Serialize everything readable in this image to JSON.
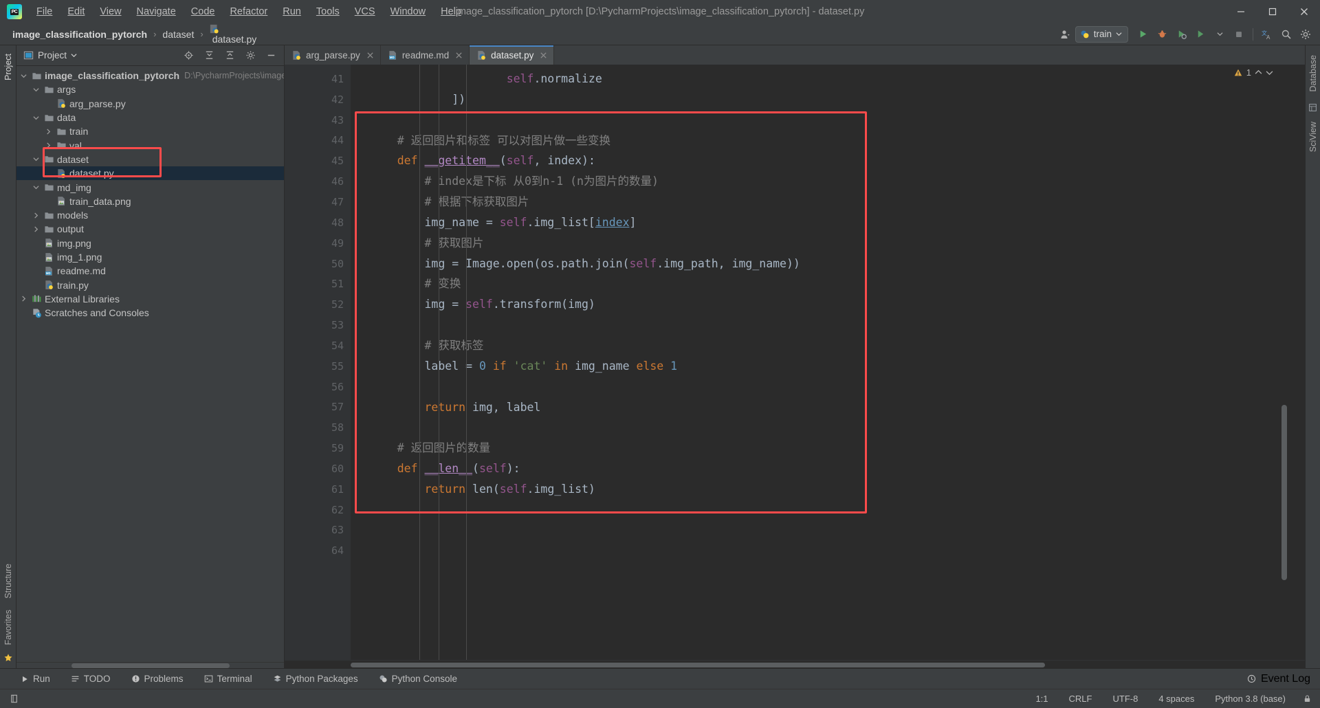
{
  "window": {
    "title": "image_classification_pytorch [D:\\PycharmProjects\\image_classification_pytorch] - dataset.py",
    "minimize_icon": "minimize-icon",
    "maximize_icon": "maximize-icon",
    "close_icon": "close-icon"
  },
  "menu": {
    "items": [
      {
        "label": "File"
      },
      {
        "label": "Edit"
      },
      {
        "label": "View"
      },
      {
        "label": "Navigate"
      },
      {
        "label": "Code"
      },
      {
        "label": "Refactor"
      },
      {
        "label": "Run"
      },
      {
        "label": "Tools"
      },
      {
        "label": "VCS"
      },
      {
        "label": "Window"
      },
      {
        "label": "Help"
      }
    ]
  },
  "breadcrumb": {
    "items": [
      {
        "label": "image_classification_pytorch",
        "icon": ""
      },
      {
        "label": "dataset",
        "icon": ""
      },
      {
        "label": "dataset.py",
        "icon": "python-file-icon"
      }
    ],
    "separator": "›"
  },
  "toolbar": {
    "run_config_label": "train",
    "run_config_icon": "python-icon",
    "dropdown_icon": "chevron-down-icon",
    "account_icon": "account-icon",
    "run_icon": "run-icon",
    "debug_icon": "debug-icon",
    "coverage_icon": "run-coverage-icon",
    "profile_icon": "profile-icon",
    "stop_icon": "stop-icon",
    "translate_icon": "translate-icon",
    "search_icon": "search-icon",
    "settings_icon": "gear-icon"
  },
  "left_strip": {
    "top_items": [
      {
        "label": "Project"
      }
    ],
    "bottom_items": [
      {
        "label": "Structure"
      },
      {
        "label": "Favorites"
      }
    ]
  },
  "right_strip": {
    "items": [
      {
        "label": "Database"
      },
      {
        "label": "SciView"
      }
    ]
  },
  "project_panel": {
    "title": "Project",
    "dropdown_icon": "chevron-down-icon",
    "icons": [
      {
        "name": "locate-icon"
      },
      {
        "name": "collapse-all-icon"
      },
      {
        "name": "expand-all-icon"
      },
      {
        "name": "gear-icon"
      },
      {
        "name": "hide-icon"
      }
    ],
    "tree": [
      {
        "depth": 0,
        "arrow": "open",
        "icon": "folder-icon",
        "label": "image_classification_pytorch",
        "bold": true,
        "path": "D:\\PycharmProjects\\image_",
        "selected": false
      },
      {
        "depth": 1,
        "arrow": "open",
        "icon": "folder-icon",
        "label": "args",
        "bold": false,
        "path": "",
        "selected": false
      },
      {
        "depth": 2,
        "arrow": "none",
        "icon": "python-file-icon",
        "label": "arg_parse.py",
        "bold": false,
        "path": "",
        "selected": false
      },
      {
        "depth": 1,
        "arrow": "open",
        "icon": "folder-icon",
        "label": "data",
        "bold": false,
        "path": "",
        "selected": false
      },
      {
        "depth": 2,
        "arrow": "closed",
        "icon": "folder-icon",
        "label": "train",
        "bold": false,
        "path": "",
        "selected": false
      },
      {
        "depth": 2,
        "arrow": "closed",
        "icon": "folder-icon",
        "label": "val",
        "bold": false,
        "path": "",
        "selected": false
      },
      {
        "depth": 1,
        "arrow": "open",
        "icon": "folder-icon",
        "label": "dataset",
        "bold": false,
        "path": "",
        "selected": false
      },
      {
        "depth": 2,
        "arrow": "none",
        "icon": "python-file-icon",
        "label": "dataset.py",
        "bold": false,
        "path": "",
        "selected": true
      },
      {
        "depth": 1,
        "arrow": "open",
        "icon": "folder-icon",
        "label": "md_img",
        "bold": false,
        "path": "",
        "selected": false
      },
      {
        "depth": 2,
        "arrow": "none",
        "icon": "image-file-icon",
        "label": "train_data.png",
        "bold": false,
        "path": "",
        "selected": false
      },
      {
        "depth": 1,
        "arrow": "closed",
        "icon": "folder-icon",
        "label": "models",
        "bold": false,
        "path": "",
        "selected": false
      },
      {
        "depth": 1,
        "arrow": "closed",
        "icon": "folder-icon",
        "label": "output",
        "bold": false,
        "path": "",
        "selected": false
      },
      {
        "depth": 1,
        "arrow": "none",
        "icon": "image-file-icon",
        "label": "img.png",
        "bold": false,
        "path": "",
        "selected": false
      },
      {
        "depth": 1,
        "arrow": "none",
        "icon": "image-file-icon",
        "label": "img_1.png",
        "bold": false,
        "path": "",
        "selected": false
      },
      {
        "depth": 1,
        "arrow": "none",
        "icon": "markdown-file-icon",
        "label": "readme.md",
        "bold": false,
        "path": "",
        "selected": false
      },
      {
        "depth": 1,
        "arrow": "none",
        "icon": "python-file-icon",
        "label": "train.py",
        "bold": false,
        "path": "",
        "selected": false
      },
      {
        "depth": 0,
        "arrow": "closed",
        "icon": "library-icon",
        "label": "External Libraries",
        "bold": false,
        "path": "",
        "selected": false
      },
      {
        "depth": 0,
        "arrow": "none",
        "icon": "scratches-icon",
        "label": "Scratches and Consoles",
        "bold": false,
        "path": "",
        "selected": false
      }
    ]
  },
  "editor": {
    "tabs": [
      {
        "label": "arg_parse.py",
        "icon": "python-file-icon",
        "active": false,
        "close_icon": "close-icon"
      },
      {
        "label": "readme.md",
        "icon": "markdown-file-icon",
        "active": false,
        "close_icon": "close-icon"
      },
      {
        "label": "dataset.py",
        "icon": "python-file-icon",
        "active": true,
        "close_icon": "close-icon"
      }
    ],
    "inspection": {
      "count": "1",
      "icon": "warning-icon",
      "up_icon": "chevron-up-icon",
      "down_icon": "chevron-down-icon"
    },
    "first_line_number": 41,
    "lines": [
      {
        "n": 41,
        "fold": false,
        "gutter_icon": "",
        "tokens": [
          {
            "t": "                    ",
            "c": "id"
          },
          {
            "t": "self",
            "c": "self"
          },
          {
            "t": ".",
            "c": "punct"
          },
          {
            "t": "normalize",
            "c": "id"
          }
        ]
      },
      {
        "n": 42,
        "fold": true,
        "gutter_icon": "",
        "tokens": [
          {
            "t": "            ])",
            "c": "punct"
          }
        ]
      },
      {
        "n": 43,
        "fold": false,
        "gutter_icon": "",
        "tokens": []
      },
      {
        "n": 44,
        "fold": false,
        "gutter_icon": "",
        "tokens": [
          {
            "t": "    # 返回图片和标签 可以对图片做一些变换",
            "c": "cmt"
          }
        ]
      },
      {
        "n": 45,
        "fold": true,
        "gutter_icon": "override-icon",
        "tokens": [
          {
            "t": "    ",
            "c": "id"
          },
          {
            "t": "def ",
            "c": "kw"
          },
          {
            "t": "__getitem__",
            "c": "fnmagic"
          },
          {
            "t": "(",
            "c": "punct"
          },
          {
            "t": "self",
            "c": "self"
          },
          {
            "t": ", ",
            "c": "punct"
          },
          {
            "t": "index",
            "c": "param"
          },
          {
            "t": "):",
            "c": "punct"
          }
        ]
      },
      {
        "n": 46,
        "fold": true,
        "gutter_icon": "",
        "tokens": [
          {
            "t": "        # index是下标 从0到n-1 (n为图片的数量)",
            "c": "cmt"
          }
        ]
      },
      {
        "n": 47,
        "fold": true,
        "gutter_icon": "",
        "tokens": [
          {
            "t": "        # 根据下标获取图片",
            "c": "cmt"
          }
        ]
      },
      {
        "n": 48,
        "fold": false,
        "gutter_icon": "",
        "tokens": [
          {
            "t": "        img_name = ",
            "c": "id"
          },
          {
            "t": "self",
            "c": "self"
          },
          {
            "t": ".img_list[",
            "c": "id"
          },
          {
            "t": "index",
            "c": "link"
          },
          {
            "t": "]",
            "c": "punct"
          }
        ]
      },
      {
        "n": 49,
        "fold": false,
        "gutter_icon": "",
        "tokens": [
          {
            "t": "        # 获取图片",
            "c": "cmt"
          }
        ]
      },
      {
        "n": 50,
        "fold": false,
        "gutter_icon": "",
        "tokens": [
          {
            "t": "        img = Image.open(os.path.join(",
            "c": "id"
          },
          {
            "t": "self",
            "c": "self"
          },
          {
            "t": ".img_path, img_name))",
            "c": "id"
          }
        ]
      },
      {
        "n": 51,
        "fold": false,
        "gutter_icon": "",
        "tokens": [
          {
            "t": "        # 变换",
            "c": "cmt"
          }
        ]
      },
      {
        "n": 52,
        "fold": false,
        "gutter_icon": "",
        "tokens": [
          {
            "t": "        img = ",
            "c": "id"
          },
          {
            "t": "self",
            "c": "self"
          },
          {
            "t": ".transform(img)",
            "c": "id"
          }
        ]
      },
      {
        "n": 53,
        "fold": false,
        "gutter_icon": "",
        "tokens": []
      },
      {
        "n": 54,
        "fold": false,
        "gutter_icon": "",
        "tokens": [
          {
            "t": "        # 获取标签",
            "c": "cmt"
          }
        ]
      },
      {
        "n": 55,
        "fold": false,
        "gutter_icon": "",
        "tokens": [
          {
            "t": "        label = ",
            "c": "id"
          },
          {
            "t": "0",
            "c": "num"
          },
          {
            "t": " ",
            "c": "id"
          },
          {
            "t": "if ",
            "c": "kw"
          },
          {
            "t": "'cat'",
            "c": "str"
          },
          {
            "t": " ",
            "c": "id"
          },
          {
            "t": "in ",
            "c": "kw"
          },
          {
            "t": "img_name ",
            "c": "id"
          },
          {
            "t": "else ",
            "c": "kw"
          },
          {
            "t": "1",
            "c": "num"
          }
        ]
      },
      {
        "n": 56,
        "fold": false,
        "gutter_icon": "",
        "tokens": []
      },
      {
        "n": 57,
        "fold": true,
        "gutter_icon": "",
        "tokens": [
          {
            "t": "        ",
            "c": "id"
          },
          {
            "t": "return ",
            "c": "kw"
          },
          {
            "t": "img, label",
            "c": "id"
          }
        ]
      },
      {
        "n": 58,
        "fold": false,
        "gutter_icon": "",
        "tokens": []
      },
      {
        "n": 59,
        "fold": false,
        "gutter_icon": "",
        "tokens": [
          {
            "t": "    # 返回图片的数量",
            "c": "cmt"
          }
        ]
      },
      {
        "n": 60,
        "fold": true,
        "gutter_icon": "",
        "tokens": [
          {
            "t": "    ",
            "c": "id"
          },
          {
            "t": "def ",
            "c": "kw"
          },
          {
            "t": "__len__",
            "c": "fnmagic"
          },
          {
            "t": "(",
            "c": "punct"
          },
          {
            "t": "self",
            "c": "self"
          },
          {
            "t": "):",
            "c": "punct"
          }
        ]
      },
      {
        "n": 61,
        "fold": true,
        "gutter_icon": "",
        "tokens": [
          {
            "t": "        ",
            "c": "id"
          },
          {
            "t": "return ",
            "c": "kw"
          },
          {
            "t": "len(",
            "c": "id"
          },
          {
            "t": "self",
            "c": "self"
          },
          {
            "t": ".img_list)",
            "c": "id"
          }
        ]
      },
      {
        "n": 62,
        "fold": false,
        "gutter_icon": "",
        "tokens": []
      },
      {
        "n": 63,
        "fold": false,
        "gutter_icon": "",
        "tokens": []
      },
      {
        "n": 64,
        "fold": false,
        "gutter_icon": "",
        "tokens": []
      }
    ]
  },
  "bottom_bar": {
    "items": [
      {
        "label": "Run",
        "icon": "run-icon"
      },
      {
        "label": "TODO",
        "icon": "todo-icon"
      },
      {
        "label": "Problems",
        "icon": "problems-icon"
      },
      {
        "label": "Terminal",
        "icon": "terminal-icon"
      },
      {
        "label": "Python Packages",
        "icon": "packages-icon"
      },
      {
        "label": "Python Console",
        "icon": "python-icon"
      }
    ],
    "event_log": {
      "label": "Event Log",
      "icon": "event-log-icon"
    }
  },
  "status_bar": {
    "caret": "1:1",
    "line_separator": "CRLF",
    "encoding": "UTF-8",
    "indent": "4 spaces",
    "interpreter": "Python 3.8 (base)",
    "lock_icon": "lock-icon"
  },
  "colors": {
    "accent": "#4a88c7",
    "annotation": "#fc4b4b",
    "selection": "#1b2b3a",
    "editor_bg": "#2b2b2b",
    "panel_bg": "#3c3f41"
  }
}
